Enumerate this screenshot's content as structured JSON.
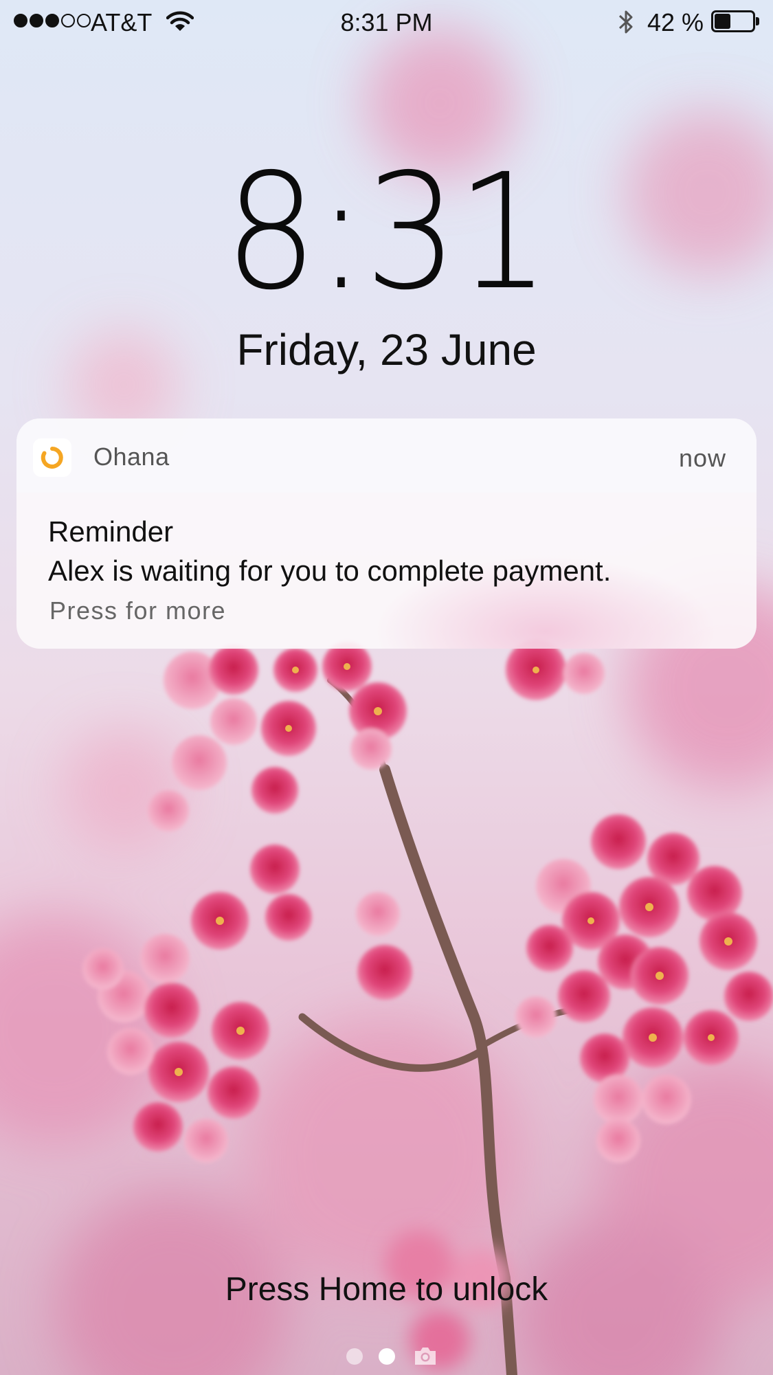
{
  "status_bar": {
    "signal_bars_filled": 3,
    "signal_bars_total": 5,
    "carrier": "AT&T",
    "time": "8:31 PM",
    "battery_percent_label": "42 %",
    "battery_level": 0.42,
    "icons": [
      "wifi-icon",
      "bluetooth-icon",
      "battery-icon"
    ]
  },
  "lock_screen": {
    "time": "8:31",
    "date": "Friday, 23 June"
  },
  "notification": {
    "app_name": "Ohana",
    "timestamp": "now",
    "title": "Reminder",
    "body": "Alex is waiting for you to complete payment.",
    "hint": "Press for more",
    "app_icon": "ohana-logo-icon",
    "accent_color": "#f5a623"
  },
  "bottom": {
    "unlock_hint": "Press Home to unlock",
    "page_count": 2,
    "current_page": 2,
    "camera_icon": "camera-icon"
  }
}
